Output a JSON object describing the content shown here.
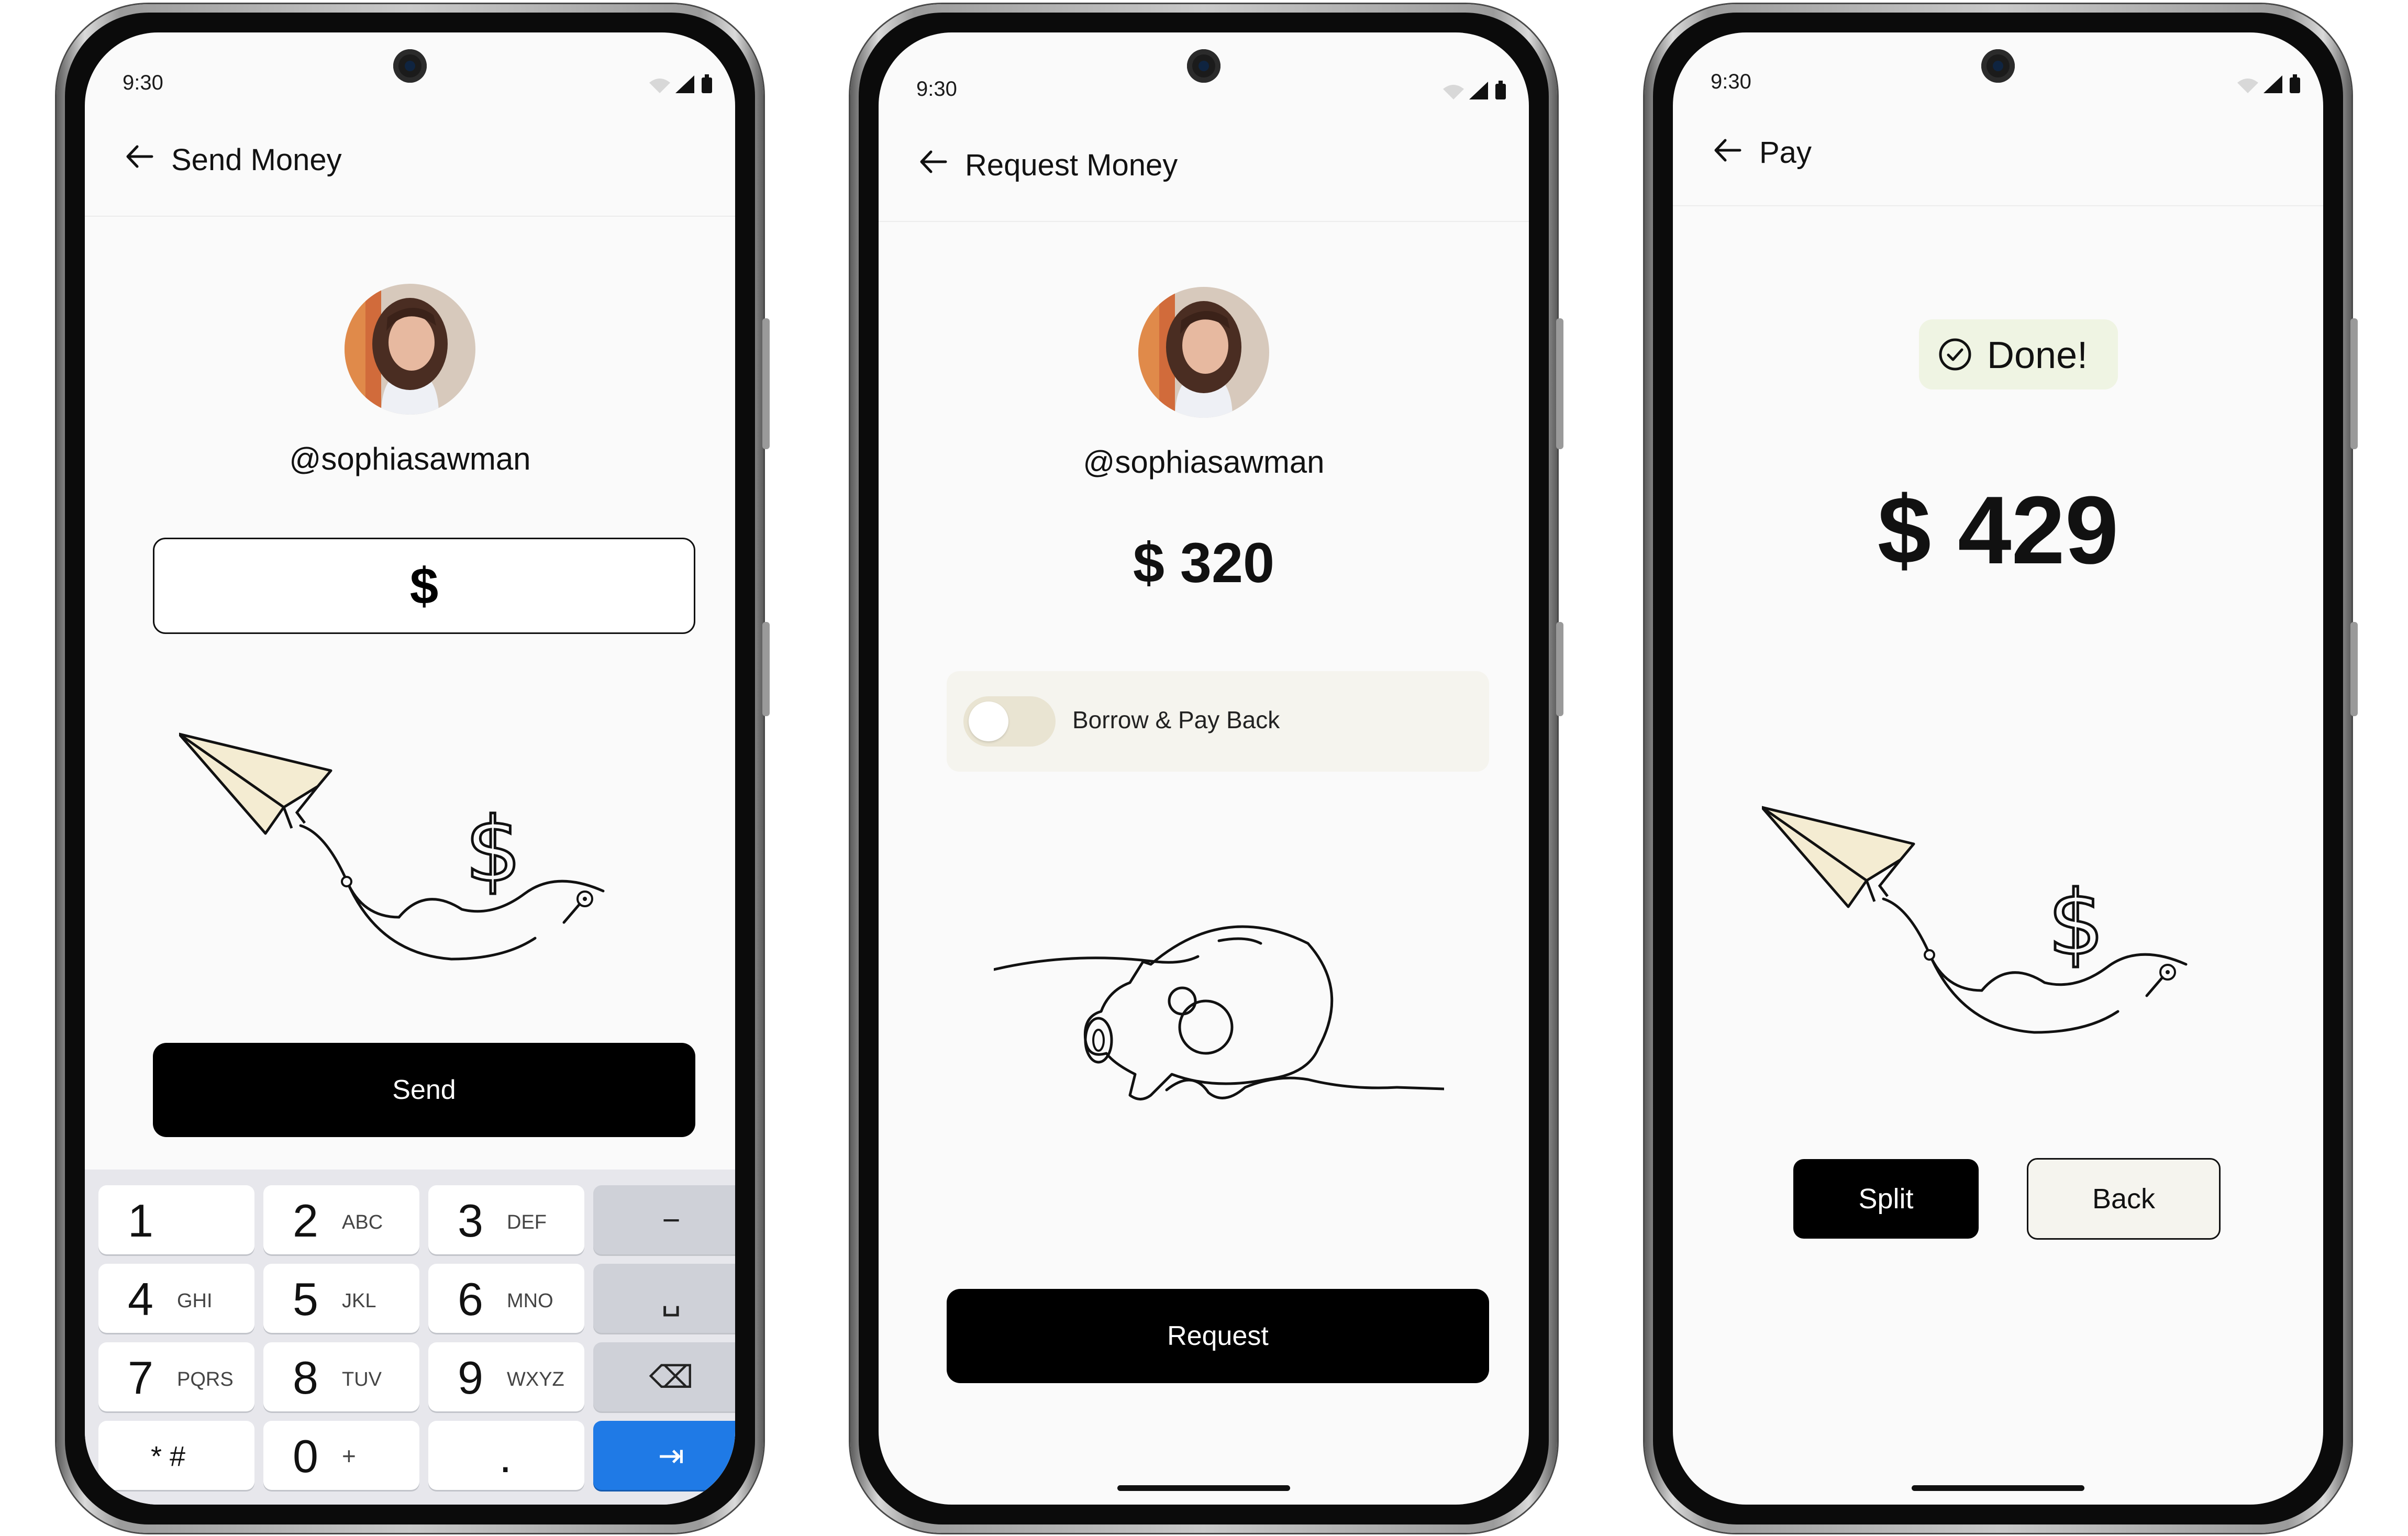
{
  "colors": {
    "screen_background": "#fafafa",
    "primary_button": "#000000",
    "keypad_background": "#e7e7ec",
    "enter_key": "#1f7ae6",
    "toggle_row": "#f5f4ee",
    "done_badge": "#eff4e3",
    "back_button": "#f5f4ee",
    "illustration_fill": "#f4ecd2"
  },
  "status_bar": {
    "time": "9:30"
  },
  "send_screen": {
    "title": "Send Money",
    "back_icon": "arrow-left-icon",
    "username": "@sophiasawman",
    "amount_field": {
      "value": "$"
    },
    "illustration": "paper-plane-dollar-illustration",
    "send_button": "Send",
    "keypad": {
      "rows": [
        [
          {
            "num": "1",
            "sub": ""
          },
          {
            "num": "2",
            "sub": "ABC"
          },
          {
            "num": "3",
            "sub": "DEF"
          },
          {
            "glyph": "−"
          }
        ],
        [
          {
            "num": "4",
            "sub": "GHI"
          },
          {
            "num": "5",
            "sub": "JKL"
          },
          {
            "num": "6",
            "sub": "MNO"
          },
          {
            "glyph": "␣"
          }
        ],
        [
          {
            "num": "7",
            "sub": "PQRS"
          },
          {
            "num": "8",
            "sub": "TUV"
          },
          {
            "num": "9",
            "sub": "WXYZ"
          },
          {
            "glyph": "⌫"
          }
        ],
        [
          {
            "num": "* #",
            "sub": ""
          },
          {
            "num": "0",
            "sub": "+"
          },
          {
            "num": ".",
            "sub": ""
          },
          {
            "glyph": "⇥"
          }
        ]
      ]
    }
  },
  "request_screen": {
    "title": "Request Money",
    "back_icon": "arrow-left-icon",
    "username": "@sophiasawman",
    "amount": "$ 320",
    "toggle": {
      "label": "Borrow & Pay Back",
      "on": false
    },
    "illustration": "piggy-bank-line-illustration",
    "request_button": "Request"
  },
  "pay_screen": {
    "title": "Pay",
    "back_icon": "arrow-left-icon",
    "status_badge": "Done!",
    "amount": "$ 429",
    "illustration": "paper-plane-dollar-illustration",
    "split_button": "Split",
    "back_button": "Back"
  }
}
